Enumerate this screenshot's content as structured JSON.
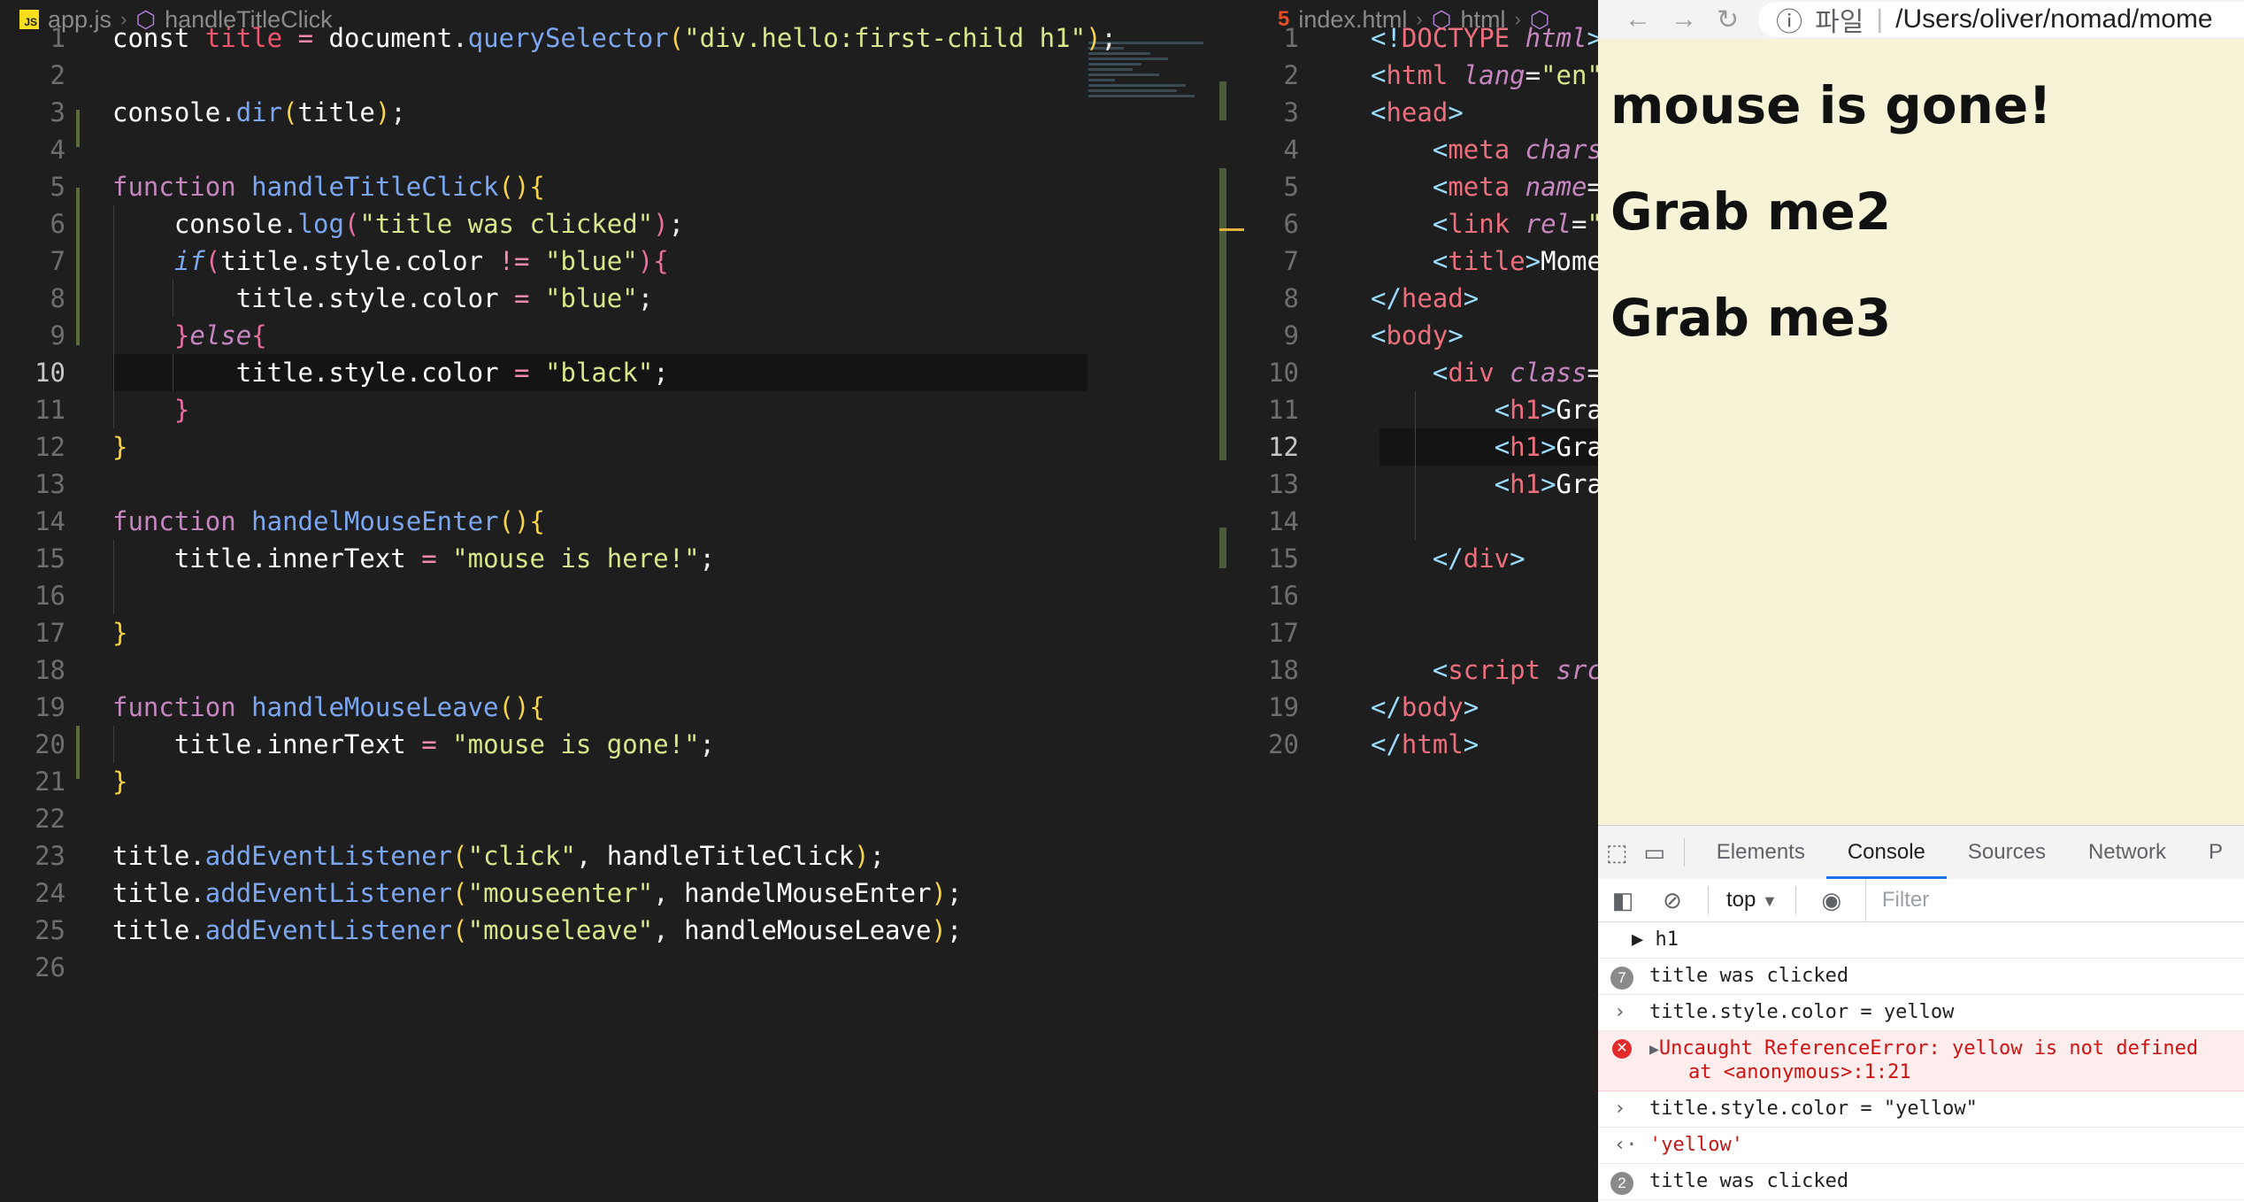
{
  "editor_left": {
    "file": "app.js",
    "symbol": "handleTitleClick",
    "current_line": 10
  },
  "editor_right": {
    "file": "index.html",
    "crumb1": "html",
    "current_line": 12
  },
  "browser": {
    "address": "/Users/oliver/nomad/mome",
    "address_prefix": "파일",
    "headings": [
      "mouse is gone!",
      "Grab me2",
      "Grab me3"
    ]
  },
  "devtools": {
    "tabs": [
      "Elements",
      "Console",
      "Sources",
      "Network",
      "P"
    ],
    "active_tab": "Console",
    "context": "top",
    "filter_placeholder": "Filter",
    "messages": [
      {
        "type": "log",
        "text": "▶ h1"
      },
      {
        "type": "log-count",
        "count": "7",
        "text": "title was clicked"
      },
      {
        "type": "input",
        "text": "title.style.color = yellow"
      },
      {
        "type": "error",
        "text": "Uncaught ReferenceError: yellow is not defined",
        "text2": "at <anonymous>:1:21"
      },
      {
        "type": "input",
        "text": "title.style.color = \"yellow\""
      },
      {
        "type": "result",
        "text": "'yellow'"
      },
      {
        "type": "log-count",
        "count": "2",
        "text": "title was clicked"
      }
    ]
  },
  "colors": {
    "editor_bg": "#1e1e1e",
    "page_bg": "#f6f3d6",
    "accent": "#1a73e8"
  }
}
